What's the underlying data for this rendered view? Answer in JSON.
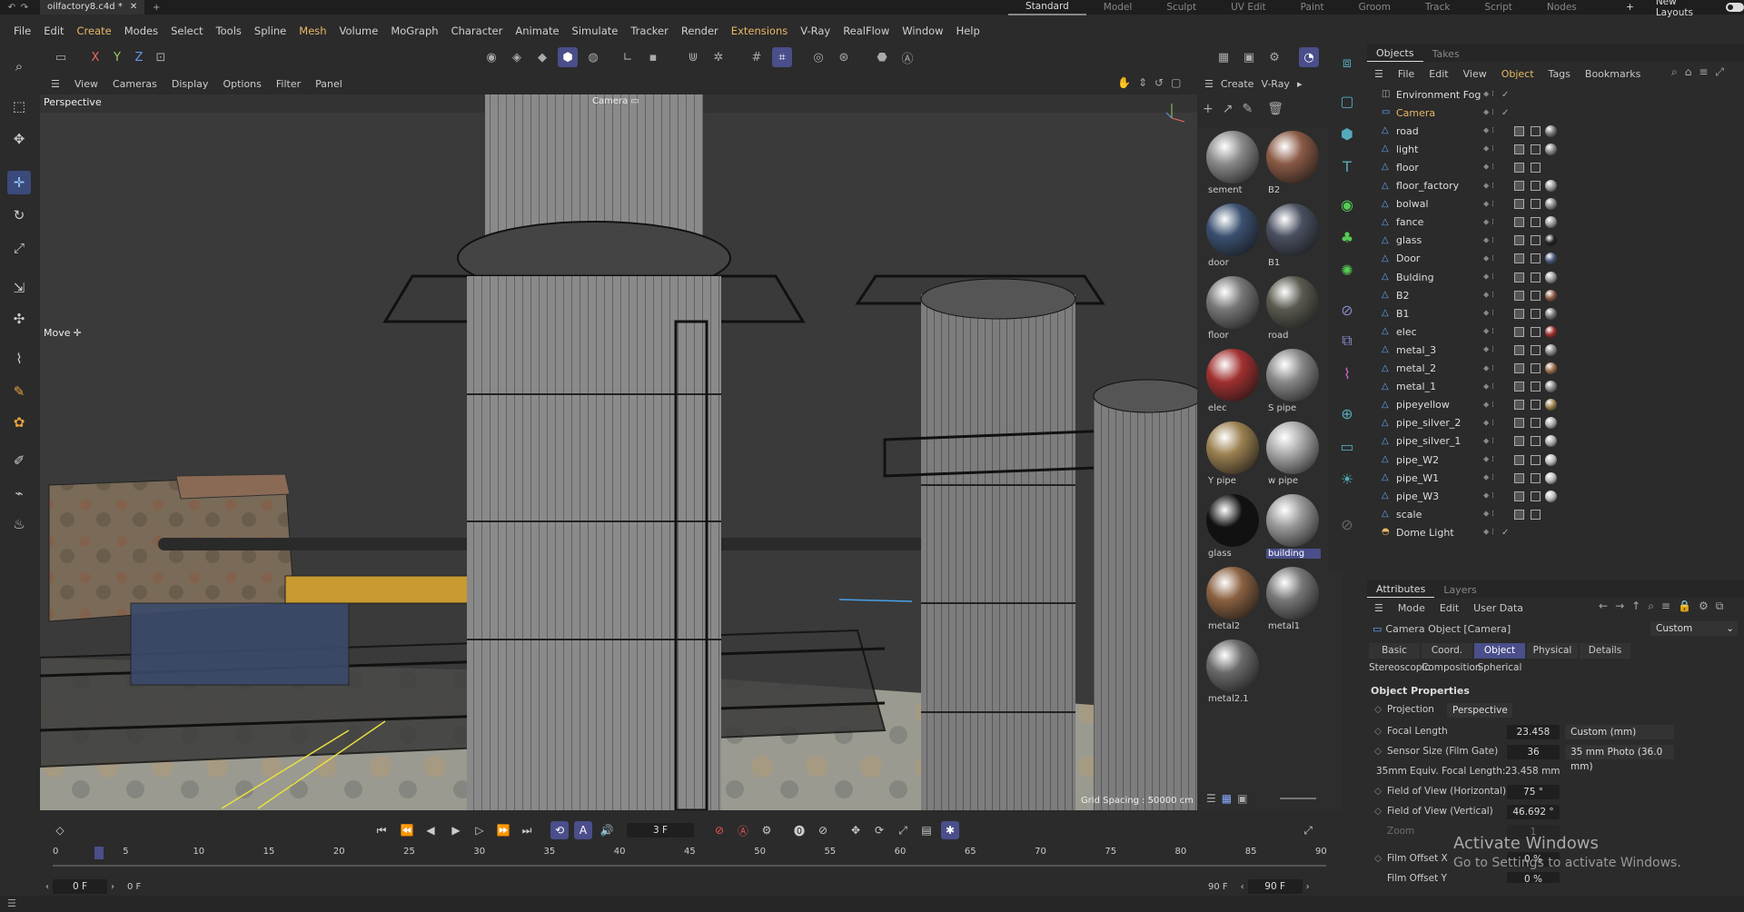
{
  "titlebar": {
    "file_tab": "oilfactory8.c4d *",
    "layouts": [
      "Standard",
      "Model",
      "Sculpt",
      "UV Edit",
      "Paint",
      "Groom",
      "Track",
      "Script",
      "Nodes"
    ],
    "active_layout": "Standard",
    "new_layouts": "New Layouts"
  },
  "menubar": [
    "File",
    "Edit",
    "Create",
    "Modes",
    "Select",
    "Tools",
    "Spline",
    "Mesh",
    "Volume",
    "MoGraph",
    "Character",
    "Animate",
    "Simulate",
    "Tracker",
    "Render",
    "Extensions",
    "V-Ray",
    "RealFlow",
    "Window",
    "Help"
  ],
  "axis_labels": [
    "X",
    "Y",
    "Z"
  ],
  "viewport": {
    "menu": [
      "View",
      "Cameras",
      "Display",
      "Options",
      "Filter",
      "Panel"
    ],
    "view_name": "Perspective",
    "camera_label": "Camera",
    "move_label": "Move",
    "grid_spacing": "Grid Spacing : 50000 cm"
  },
  "material_manager": {
    "menu": [
      "Create",
      "V-Ray"
    ],
    "materials": [
      {
        "name": "sement",
        "color": "#8a8a8a"
      },
      {
        "name": "B2",
        "color": "#8a5a45"
      },
      {
        "name": "door",
        "color": "#3a5070"
      },
      {
        "name": "B1",
        "color": "#4a5060"
      },
      {
        "name": "floor",
        "color": "#777777"
      },
      {
        "name": "road",
        "color": "#5a5a50"
      },
      {
        "name": "elec",
        "color": "#a03030"
      },
      {
        "name": "S pipe",
        "color": "#888888"
      },
      {
        "name": "Y pipe",
        "color": "#9a8050"
      },
      {
        "name": "w pipe",
        "color": "#aaaaaa"
      },
      {
        "name": "glass",
        "color": "#111111"
      },
      {
        "name": "building",
        "color": "#999999",
        "selected": true
      },
      {
        "name": "metal2",
        "color": "#8a6040"
      },
      {
        "name": "metal1",
        "color": "#777777"
      },
      {
        "name": "metal2.1",
        "color": "#6a6a6a"
      }
    ]
  },
  "objects": {
    "tabs": [
      "Objects",
      "Takes"
    ],
    "menu": [
      "File",
      "Edit",
      "View",
      "Object",
      "Tags",
      "Bookmarks"
    ],
    "items": [
      {
        "name": "Environment Fog",
        "type": "fog",
        "check": "✓"
      },
      {
        "name": "Camera",
        "type": "camera",
        "check": "✓"
      },
      {
        "name": "road",
        "sphere": "#777"
      },
      {
        "name": "light",
        "sphere": "#888"
      },
      {
        "name": "floor",
        "sphere": ""
      },
      {
        "name": "floor_factory",
        "sphere": "#999"
      },
      {
        "name": "bolwal",
        "sphere": "#888"
      },
      {
        "name": "fance",
        "sphere": "#999"
      },
      {
        "name": "glass",
        "sphere": "#222"
      },
      {
        "name": "Door",
        "sphere": "#4a5a7a"
      },
      {
        "name": "Bulding",
        "sphere": "#999"
      },
      {
        "name": "B2",
        "sphere": "#8a5a45"
      },
      {
        "name": "B1",
        "sphere": "#777"
      },
      {
        "name": "elec",
        "sphere": "#a03030"
      },
      {
        "name": "metal_3",
        "sphere": "#888"
      },
      {
        "name": "metal_2",
        "sphere": "#9a7050"
      },
      {
        "name": "metal_1",
        "sphere": "#888"
      },
      {
        "name": "pipeyellow",
        "sphere": "#9a8050"
      },
      {
        "name": "pipe_silver_2",
        "sphere": "#aaa"
      },
      {
        "name": "pipe_silver_1",
        "sphere": "#aaa"
      },
      {
        "name": "pipe_W2",
        "sphere": "#bbb"
      },
      {
        "name": "pipe_W1",
        "sphere": "#bbb"
      },
      {
        "name": "pipe_W3",
        "sphere": "#bbb"
      },
      {
        "name": "scale",
        "sphere": ""
      },
      {
        "name": "Dome Light",
        "type": "light",
        "check": "✓"
      }
    ]
  },
  "attributes": {
    "tabs": [
      "Attributes",
      "Layers"
    ],
    "menu": [
      "Mode",
      "Edit",
      "User Data"
    ],
    "object_title": "Camera Object [Camera]",
    "mode_dropdown": "Custom",
    "tab_row1": [
      "Basic",
      "Coord.",
      "Object",
      "Physical",
      "Details"
    ],
    "tab_row2": [
      "Stereoscopic",
      "Composition",
      "Spherical"
    ],
    "active_tab": "Object",
    "section": "Object Properties",
    "projection_label": "Projection",
    "projection_value": "Perspective",
    "focal_length_label": "Focal Length",
    "focal_length_value": "23.458",
    "focal_preset": "Custom (mm)",
    "sensor_label": "Sensor Size (Film Gate)",
    "sensor_value": "36",
    "sensor_preset": "35 mm Photo (36.0 mm)",
    "equiv_label": "35mm Equiv. Focal Length:",
    "equiv_value": "23.458 mm",
    "fovh_label": "Field of View (Horizontal)",
    "fovh_value": "75 °",
    "fovv_label": "Field of View (Vertical)",
    "fovv_value": "46.692 °",
    "zoom_label": "Zoom",
    "zoom_value": "1",
    "offx_label": "Film Offset X",
    "offx_value": "0 %",
    "offy_label": "Film Offset Y",
    "offy_value": "0 %"
  },
  "timeline": {
    "current_frame": "3 F",
    "start_field": "0 F",
    "start_field2": "0 F",
    "end_field": "90 F",
    "end_field2": "90 F",
    "ticks": [
      "0",
      "5",
      "10",
      "15",
      "20",
      "25",
      "30",
      "35",
      "40",
      "45",
      "50",
      "55",
      "60",
      "65",
      "70",
      "75",
      "80",
      "85",
      "90"
    ],
    "playhead_frame": 3
  },
  "watermark": {
    "line1": "Activate Windows",
    "line2": "Go to Settings to activate Windows."
  },
  "colors": {
    "accent": "#4a4e8a",
    "highlight": "#e8b866"
  }
}
